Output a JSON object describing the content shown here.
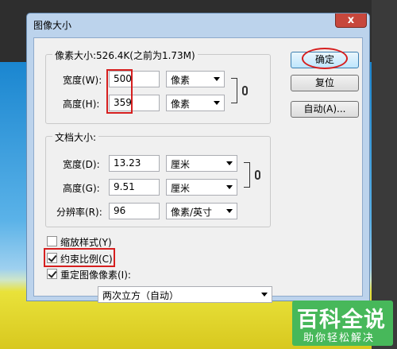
{
  "dialog": {
    "title": "图像大小",
    "close_symbol": "x"
  },
  "pixel_dimensions": {
    "legend": "像素大小:526.4K(之前为1.73M)",
    "width_label": "宽度(W):",
    "width_value": "500",
    "width_unit": "像素",
    "height_label": "高度(H):",
    "height_value": "359",
    "height_unit": "像素"
  },
  "document_size": {
    "legend": "文档大小:",
    "width_label": "宽度(D):",
    "width_value": "13.23",
    "width_unit": "厘米",
    "height_label": "高度(G):",
    "height_value": "9.51",
    "height_unit": "厘米",
    "resolution_label": "分辨率(R):",
    "resolution_value": "96",
    "resolution_unit": "像素/英寸"
  },
  "buttons": {
    "ok": "确定",
    "reset": "复位",
    "auto": "自动(A)..."
  },
  "options": {
    "scale_styles": {
      "label": "缩放样式(Y)",
      "checked": false
    },
    "constrain_proportions": {
      "label": "约束比例(C)",
      "checked": true
    },
    "resample": {
      "label": "重定图像像素(I):",
      "checked": true
    },
    "resample_method": "两次立方（自动）"
  },
  "watermark": {
    "title": "百科全说",
    "subtitle": "助你轻松解决"
  },
  "colors": {
    "annotation_red": "#d61f1f",
    "watermark_green": "#47b85a",
    "dialog_frame": "#bcd3ec"
  }
}
